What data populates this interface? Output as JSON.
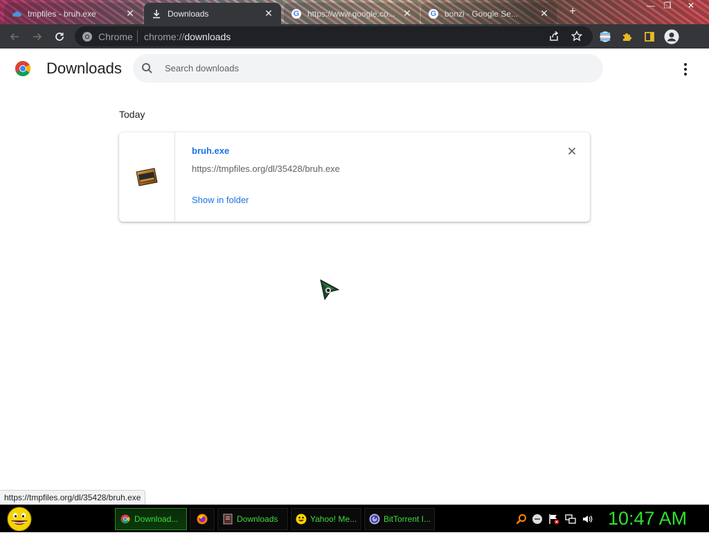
{
  "window": {
    "tabs": [
      {
        "title": "tmpfiles - bruh.exe",
        "favicon": "cloud-icon",
        "active": false
      },
      {
        "title": "Downloads",
        "favicon": "download-icon",
        "active": true
      },
      {
        "title": "https://www.google.co...",
        "favicon": "google-icon",
        "active": false
      },
      {
        "title": "bonzi - Google Se...",
        "favicon": "google-icon",
        "active": false
      }
    ],
    "new_tab_glyph": "+",
    "controls": {
      "minimize": "—",
      "restore": "❐",
      "close": "✕"
    }
  },
  "toolbar": {
    "scheme_label": "Chrome",
    "url_prefix": "chrome://",
    "url_host": "downloads",
    "icons": [
      "back-icon",
      "forward-icon",
      "reload-icon",
      "share-icon",
      "bookmark-star-icon",
      "flag-extension-icon",
      "puzzle-extensions-icon",
      "side-panel-icon",
      "profile-avatar-icon"
    ]
  },
  "page": {
    "title": "Downloads",
    "search_placeholder": "Search downloads",
    "date_heading": "Today",
    "downloads": [
      {
        "file_name": "bruh.exe",
        "url": "https://tmpfiles.org/dl/35428/bruh.exe",
        "action": "Show in folder",
        "remove_glyph": "✕"
      }
    ]
  },
  "status_bar": {
    "url": "https://tmpfiles.org/dl/35428/bruh.exe"
  },
  "taskbar": {
    "start_icon": "smiley-start-icon",
    "tasks": [
      {
        "label": "Download...",
        "icon": "chrome-icon",
        "active": true
      },
      {
        "label": "",
        "icon": "firefox-icon",
        "active": false
      },
      {
        "label": "Downloads",
        "icon": "downloads-folder-icon",
        "active": false
      },
      {
        "label": "Yahoo! Me...",
        "icon": "yahoo-messenger-icon",
        "active": false
      },
      {
        "label": "BitTorrent I...",
        "icon": "bittorrent-icon",
        "active": false
      }
    ],
    "tray_icons": [
      "search-tray-icon",
      "messenger-tray-icon",
      "action-center-flag-icon",
      "network-icon",
      "volume-icon"
    ],
    "clock": "10:47 AM"
  },
  "colors": {
    "accent_link": "#1a73e8",
    "toolbar_bg": "#35363a",
    "omnibox_bg": "#202124",
    "taskbar_text": "#3ddc3d"
  }
}
